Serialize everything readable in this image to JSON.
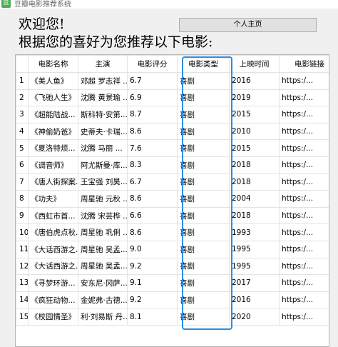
{
  "window": {
    "title": "豆瓣电影推荐系统",
    "icon": "app-icon"
  },
  "header": {
    "welcome": "欢迎您!",
    "profile_button": "个人主页",
    "subtitle": "根据您的喜好为您推荐以下电影:"
  },
  "table": {
    "columns": [
      "",
      "电影名称",
      "主演",
      "电影评分",
      "电影类型",
      "上映时间",
      "电影链接"
    ],
    "rows": [
      [
        "1",
        "《美人鱼》",
        "邓超  罗志祥 ...",
        "6.7",
        "喜剧",
        "2016",
        "https:/..."
      ],
      [
        "2",
        "《飞驰人生》",
        "沈腾  黄景瑜 ...",
        "6.9",
        "喜剧",
        "2019",
        "https:/..."
      ],
      [
        "3",
        "《超能陆战...",
        "斯科特·安第...",
        "8.7",
        "喜剧",
        "2015",
        "https:/..."
      ],
      [
        "4",
        "《神偷奶爸》",
        "史蒂夫·卡瑞...",
        "8.6",
        "喜剧",
        "2010",
        "https:/..."
      ],
      [
        "5",
        "《夏洛特烦...",
        "沈腾  马丽 ...",
        "7.6",
        "喜剧",
        "2015",
        "https:/..."
      ],
      [
        "6",
        "《调音师》",
        "阿尤斯曼·库...",
        "8.3",
        "喜剧",
        "2018",
        "https:/..."
      ],
      [
        "7",
        "《唐人街探案...",
        "王宝强  刘昊...",
        "6.7",
        "喜剧",
        "2018",
        "https:/..."
      ],
      [
        "8",
        "《功夫》",
        "周星驰  元秋 ...",
        "8.6",
        "喜剧",
        "2004",
        "https:/..."
      ],
      [
        "9",
        "《西虹市首...",
        "沈腾  宋芸桦 ...",
        "6.6",
        "喜剧",
        "2018",
        "https:/..."
      ],
      [
        "10",
        "《唐伯虎点秋...",
        "周星驰  巩俐 ...",
        "8.6",
        "喜剧",
        "1993",
        "https:/..."
      ],
      [
        "11",
        "《大话西游之...",
        "周星驰  吴孟...",
        "9.0",
        "喜剧",
        "1995",
        "https:/..."
      ],
      [
        "12",
        "《大话西游之...",
        "周星驰  吴孟...",
        "9.2",
        "喜剧",
        "1995",
        "https:/..."
      ],
      [
        "13",
        "《寻梦环游...",
        "安东尼·冈萨...",
        "9.1",
        "喜剧",
        "2017",
        "https:/..."
      ],
      [
        "14",
        "《疯狂动物...",
        "金妮弗·古德...",
        "9.2",
        "喜剧",
        "2016",
        "https:/..."
      ],
      [
        "15",
        "《校园情圣》",
        "利·刘易斯  丹...",
        "8.1",
        "喜剧",
        "2020",
        "https:/..."
      ]
    ]
  },
  "colors": {
    "highlight": "#2e8be6",
    "app_icon": "#4caf50"
  }
}
